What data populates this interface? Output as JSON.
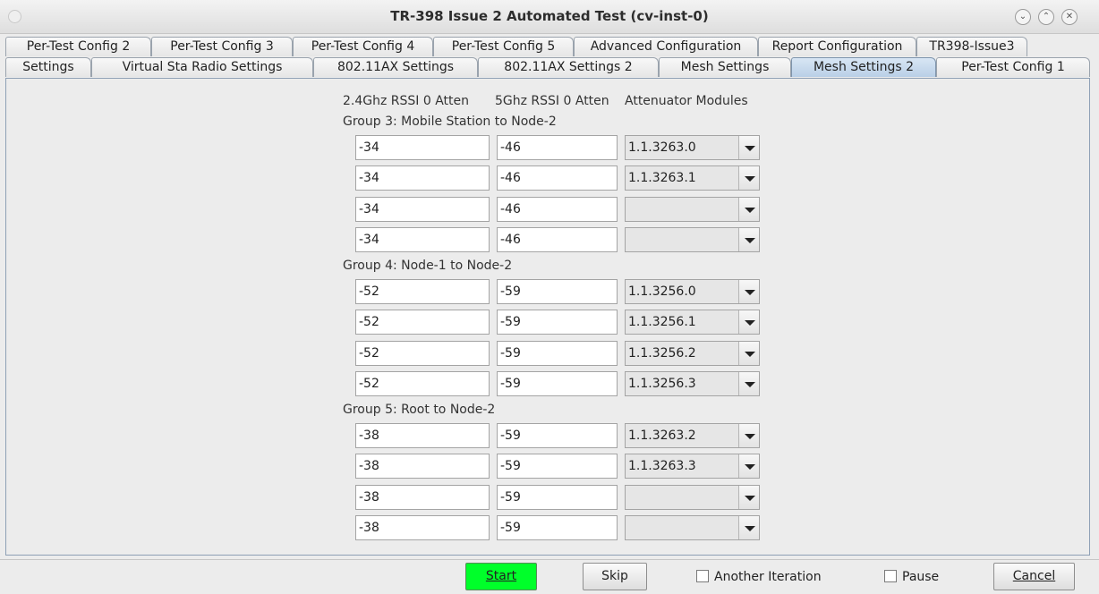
{
  "window": {
    "title": "TR-398 Issue 2 Automated Test  (cv-inst-0)"
  },
  "tabs_row1": [
    "Per-Test Config 2",
    "Per-Test Config 3",
    "Per-Test Config 4",
    "Per-Test Config 5",
    "Advanced Configuration",
    "Report Configuration",
    "TR398-Issue3"
  ],
  "tabs_row2": [
    "Settings",
    "Virtual Sta Radio Settings",
    "802.11AX Settings",
    "802.11AX Settings 2",
    "Mesh Settings",
    "Mesh Settings 2",
    "Per-Test Config 1"
  ],
  "active_tab": "Mesh Settings 2",
  "headers": {
    "rssi_24": "2.4Ghz RSSI 0 Atten",
    "rssi_5": "5Ghz RSSI 0 Atten",
    "modules": "Attenuator Modules"
  },
  "groups": [
    {
      "label": "Group 3: Mobile Station to Node-2",
      "rows": [
        {
          "rssi24": "-34",
          "rssi5": "-46",
          "module": "1.1.3263.0"
        },
        {
          "rssi24": "-34",
          "rssi5": "-46",
          "module": "1.1.3263.1"
        },
        {
          "rssi24": "-34",
          "rssi5": "-46",
          "module": ""
        },
        {
          "rssi24": "-34",
          "rssi5": "-46",
          "module": ""
        }
      ]
    },
    {
      "label": "Group 4: Node-1 to Node-2",
      "rows": [
        {
          "rssi24": "-52",
          "rssi5": "-59",
          "module": "1.1.3256.0"
        },
        {
          "rssi24": "-52",
          "rssi5": "-59",
          "module": "1.1.3256.1"
        },
        {
          "rssi24": "-52",
          "rssi5": "-59",
          "module": "1.1.3256.2"
        },
        {
          "rssi24": "-52",
          "rssi5": "-59",
          "module": "1.1.3256.3"
        }
      ]
    },
    {
      "label": "Group 5: Root to Node-2",
      "rows": [
        {
          "rssi24": "-38",
          "rssi5": "-59",
          "module": "1.1.3263.2"
        },
        {
          "rssi24": "-38",
          "rssi5": "-59",
          "module": "1.1.3263.3"
        },
        {
          "rssi24": "-38",
          "rssi5": "-59",
          "module": ""
        },
        {
          "rssi24": "-38",
          "rssi5": "-59",
          "module": ""
        }
      ]
    }
  ],
  "bottom": {
    "start": "Start",
    "skip": "Skip",
    "another_iteration": "Another Iteration",
    "another_iteration_checked": false,
    "pause": "Pause",
    "pause_checked": false,
    "cancel": "Cancel"
  },
  "colors": {
    "start_button": "#00ff2a",
    "active_tab": "#b9cfe6"
  }
}
